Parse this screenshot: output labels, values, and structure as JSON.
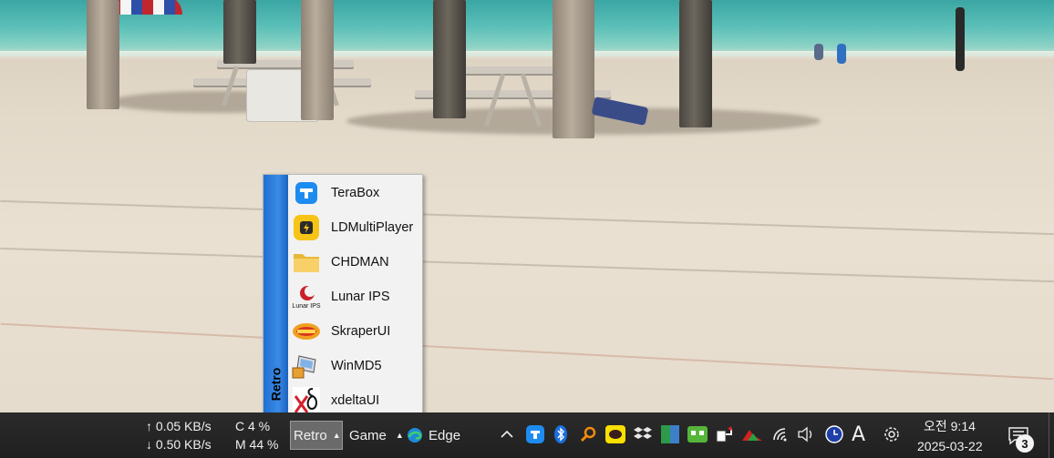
{
  "menu": {
    "group_label": "Retro",
    "items": [
      {
        "label": "TeraBox",
        "icon": "terabox-icon"
      },
      {
        "label": "LDMultiPlayer",
        "icon": "ldplayer-icon"
      },
      {
        "label": "CHDMAN",
        "icon": "folder-icon"
      },
      {
        "label": "Lunar IPS",
        "icon": "lunar-ips-icon"
      },
      {
        "label": "SkraperUI",
        "icon": "skraper-icon"
      },
      {
        "label": "WinMD5",
        "icon": "winmd5-icon"
      },
      {
        "label": "xdeltaUI",
        "icon": "xdelta-icon"
      }
    ],
    "lunar_ips_icon_text": "Lunar IPS"
  },
  "taskbar": {
    "net_up": "↑ 0.05 KB/s",
    "net_down": "↓ 0.50 KB/s",
    "cpu": "C 4 %",
    "mem": "M 44 %",
    "toolbars": [
      {
        "label": "Retro",
        "active": true
      },
      {
        "label": "Game",
        "active": false
      },
      {
        "label": "Edge",
        "active": false
      }
    ],
    "ime_label": "A",
    "time": "오전 9:14",
    "date": "2025-03-22",
    "notification_count": "3"
  },
  "colors": {
    "taskbar_bg": "#202020",
    "menu_strip": "#2a7fde",
    "menu_bg": "#f2f2f2"
  }
}
